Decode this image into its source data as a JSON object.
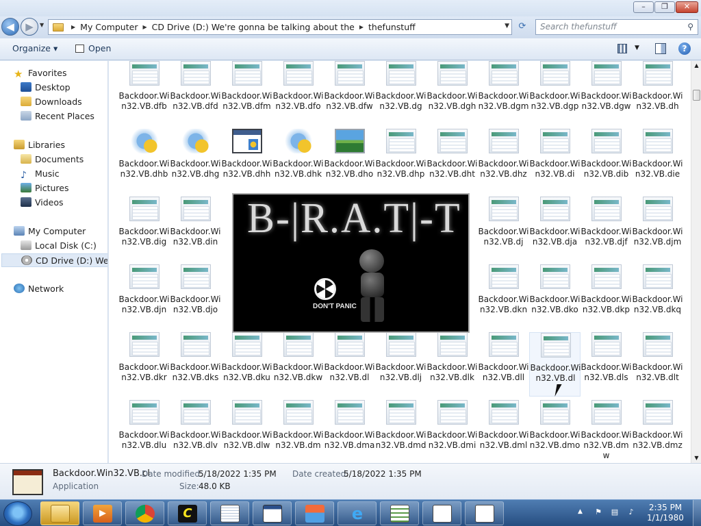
{
  "titlebar": {
    "minimize": "–",
    "maximize": "❐",
    "close": "✕"
  },
  "address": {
    "crumbs": [
      "My Computer",
      "CD Drive (D:) We're gonna be talking about the",
      "thefunstuff"
    ],
    "search_placeholder": "Search thefunstuff"
  },
  "toolbar": {
    "organize": "Organize ▾",
    "open": "Open"
  },
  "nav": {
    "favorites": "Favorites",
    "desktop": "Desktop",
    "downloads": "Downloads",
    "recent": "Recent Places",
    "libraries": "Libraries",
    "documents": "Documents",
    "music": "Music",
    "pictures": "Pictures",
    "videos": "Videos",
    "computer": "My Computer",
    "local_disk": "Local Disk (C:)",
    "cd_drive": "CD Drive (D:) We're g",
    "network": "Network"
  },
  "files": [
    [
      {
        "l": "Backdoor.Win32.VB.dfb",
        "i": "app"
      },
      {
        "l": "Backdoor.Win32.VB.dfd",
        "i": "app"
      },
      {
        "l": "Backdoor.Win32.VB.dfm",
        "i": "app"
      },
      {
        "l": "Backdoor.Win32.VB.dfo",
        "i": "app"
      },
      {
        "l": "Backdoor.Win32.VB.dfw",
        "i": "app"
      },
      {
        "l": "Backdoor.Win32.VB.dg",
        "i": "app"
      },
      {
        "l": "Backdoor.Win32.VB.dgh",
        "i": "app"
      },
      {
        "l": "Backdoor.Win32.VB.dgm",
        "i": "app"
      },
      {
        "l": "Backdoor.Win32.VB.dgp",
        "i": "app"
      },
      {
        "l": "Backdoor.Win32.VB.dgw",
        "i": "app"
      },
      {
        "l": "Backdoor.Win32.VB.dh",
        "i": "app"
      }
    ],
    [
      {
        "l": "Backdoor.Win32.VB.dhb",
        "i": "setup"
      },
      {
        "l": "Backdoor.Win32.VB.dhg",
        "i": "setup"
      },
      {
        "l": "Backdoor.Win32.VB.dhh",
        "i": "window"
      },
      {
        "l": "Backdoor.Win32.VB.dhk",
        "i": "setup"
      },
      {
        "l": "Backdoor.Win32.VB.dho",
        "i": "image"
      },
      {
        "l": "Backdoor.Win32.VB.dhp",
        "i": "app"
      },
      {
        "l": "Backdoor.Win32.VB.dht",
        "i": "app"
      },
      {
        "l": "Backdoor.Win32.VB.dhz",
        "i": "app"
      },
      {
        "l": "Backdoor.Win32.VB.di",
        "i": "app"
      },
      {
        "l": "Backdoor.Win32.VB.dib",
        "i": "app"
      },
      {
        "l": "Backdoor.Win32.VB.die",
        "i": "app"
      }
    ],
    [
      {
        "l": "Backdoor.Win32.VB.dig",
        "i": "app"
      },
      {
        "l": "Backdoor.Win32.VB.din",
        "i": "app"
      },
      null,
      null,
      null,
      null,
      null,
      {
        "l": "Backdoor.Win32.VB.dj",
        "i": "app"
      },
      {
        "l": "Backdoor.Win32.VB.dja",
        "i": "app"
      },
      {
        "l": "Backdoor.Win32.VB.djf",
        "i": "app"
      },
      {
        "l": "Backdoor.Win32.VB.djm",
        "i": "app"
      }
    ],
    [
      {
        "l": "Backdoor.Win32.VB.djn",
        "i": "app"
      },
      {
        "l": "Backdoor.Win32.VB.djo",
        "i": "app"
      },
      null,
      null,
      null,
      null,
      null,
      {
        "l": "Backdoor.Win32.VB.dkn",
        "i": "app"
      },
      {
        "l": "Backdoor.Win32.VB.dko",
        "i": "app"
      },
      {
        "l": "Backdoor.Win32.VB.dkp",
        "i": "app"
      },
      {
        "l": "Backdoor.Win32.VB.dkq",
        "i": "app"
      }
    ],
    [
      {
        "l": "Backdoor.Win32.VB.dkr",
        "i": "app"
      },
      {
        "l": "Backdoor.Win32.VB.dks",
        "i": "app"
      },
      {
        "l": "Backdoor.Win32.VB.dku",
        "i": "app"
      },
      {
        "l": "Backdoor.Win32.VB.dkw",
        "i": "app"
      },
      {
        "l": "Backdoor.Win32.VB.dl",
        "i": "app"
      },
      {
        "l": "Backdoor.Win32.VB.dlj",
        "i": "app"
      },
      {
        "l": "Backdoor.Win32.VB.dlk",
        "i": "app"
      },
      {
        "l": "Backdoor.Win32.VB.dll",
        "i": "app"
      },
      {
        "l": "Backdoor.Win32.VB.dl",
        "i": "app",
        "hover": true
      },
      {
        "l": "Backdoor.Win32.VB.dls",
        "i": "app"
      },
      {
        "l": "Backdoor.Win32.VB.dlt",
        "i": "app"
      }
    ],
    [
      {
        "l": "Backdoor.Win32.VB.dlu",
        "i": "app"
      },
      {
        "l": "Backdoor.Win32.VB.dlv",
        "i": "app"
      },
      {
        "l": "Backdoor.Win32.VB.dlw",
        "i": "app"
      },
      {
        "l": "Backdoor.Win32.VB.dm",
        "i": "app"
      },
      {
        "l": "Backdoor.Win32.VB.dma",
        "i": "app"
      },
      {
        "l": "Backdoor.Win32.VB.dmd",
        "i": "app"
      },
      {
        "l": "Backdoor.Win32.VB.dmi",
        "i": "app"
      },
      {
        "l": "Backdoor.Win32.VB.dml",
        "i": "app"
      },
      {
        "l": "Backdoor.Win32.VB.dmo",
        "i": "app"
      },
      {
        "l": "Backdoor.Win32.VB.dmw",
        "i": "app"
      },
      {
        "l": "Backdoor.Win32.VB.dmz",
        "i": "app"
      }
    ]
  ],
  "preview": {
    "title": "B-|R.A.T|-T",
    "caption": "DON'T PANIC"
  },
  "status": {
    "name": "Backdoor.Win32.VB.cl",
    "type": "Application",
    "modified_label": "Date modified:",
    "modified": "5/18/2022 1:35 PM",
    "created_label": "Date created:",
    "created": "5/18/2022 1:35 PM",
    "size_label": "Size:",
    "size": "48.0 KB"
  },
  "taskbar": {
    "time": "2:35 PM",
    "date": "1/1/1980"
  },
  "colors": {
    "accent": "#2d6bb6",
    "taskbar": "#264d80"
  }
}
